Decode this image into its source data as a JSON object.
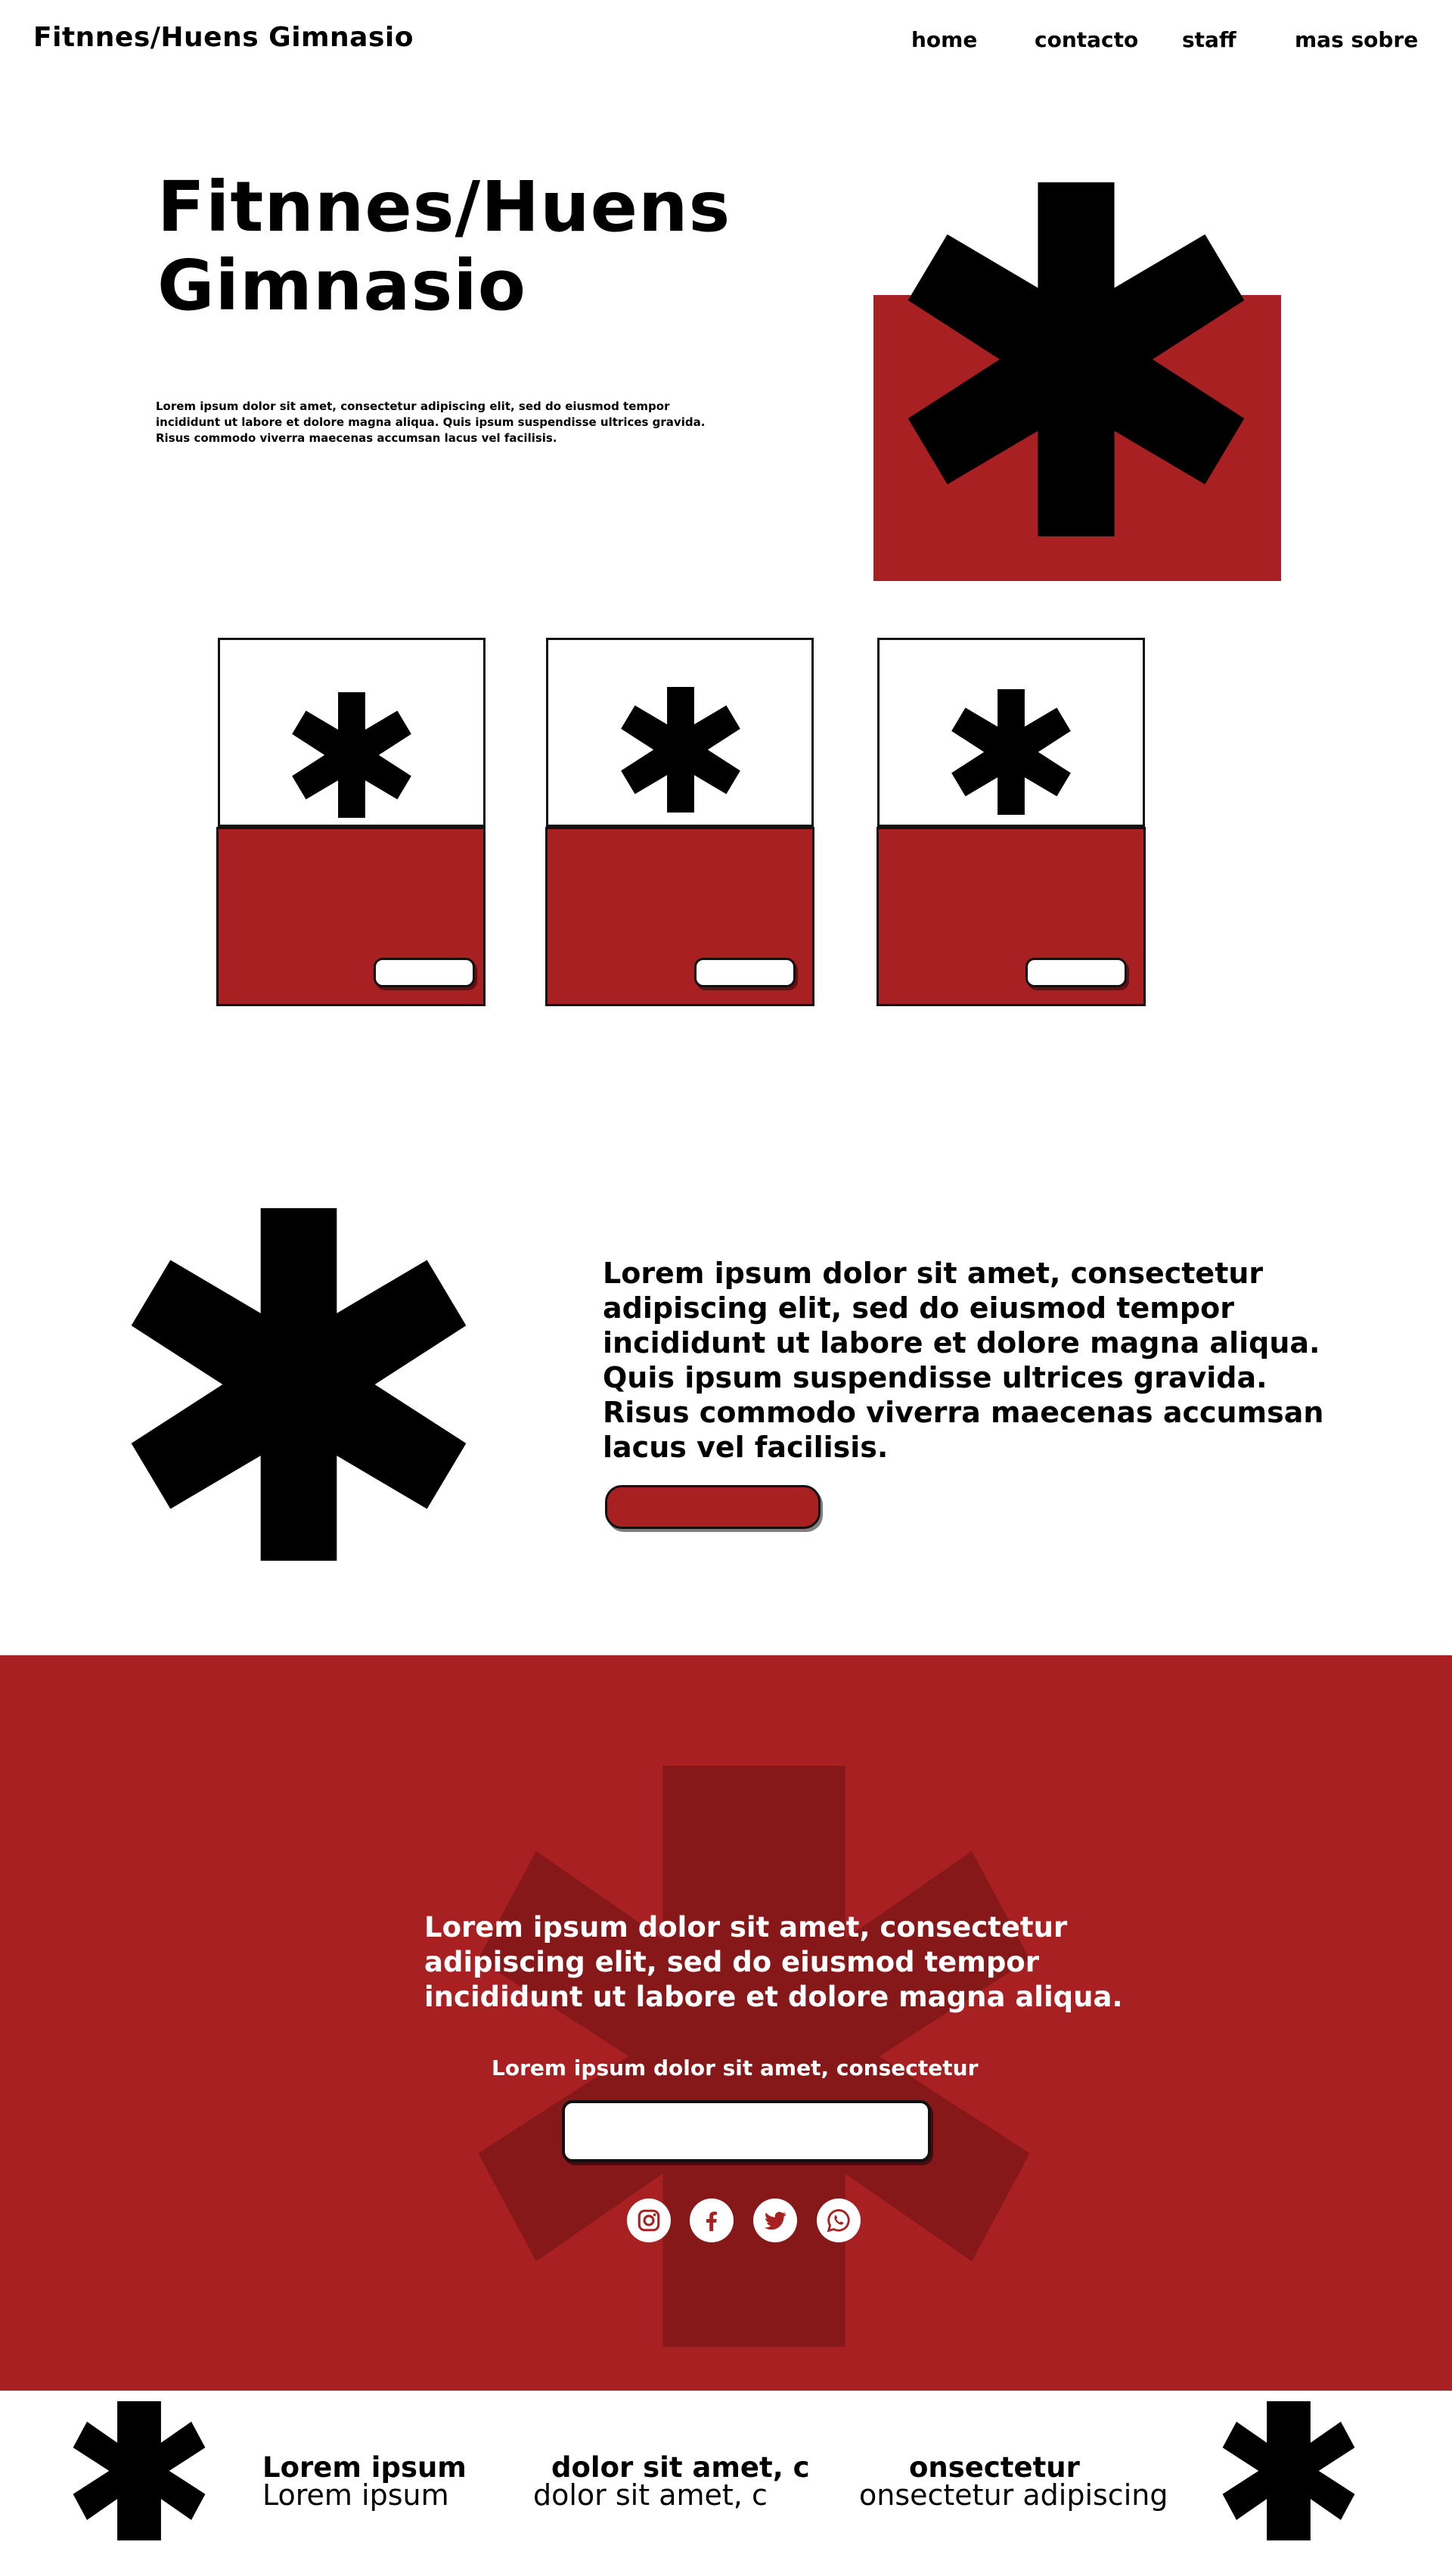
{
  "header": {
    "brand": "Fitnnes/Huens Gimnasio",
    "nav": [
      {
        "label": "home"
      },
      {
        "label": "contacto"
      },
      {
        "label": "staff"
      },
      {
        "label": "mas sobre"
      }
    ]
  },
  "hero": {
    "title": "Fitnnes/Huens Gimnasio",
    "body": "Lorem ipsum dolor sit amet, consectetur adipiscing elit, sed do eiusmod tempor incididunt ut labore et dolore magna aliqua. Quis ipsum suspendisse ultrices gravida. Risus commodo viverra maecenas accumsan lacus vel facilisis."
  },
  "feature": {
    "text": "Lorem ipsum dolor sit amet, consectetur adipiscing elit, sed do eiusmod tempor incididunt ut labore et dolore magna aliqua. Quis ipsum suspendisse ultrices gravida. Risus commodo viverra maecenas accumsan lacus vel facilisis."
  },
  "newsletter": {
    "heading": "Lorem ipsum dolor sit amet, consectetur adipiscing elit, sed do eiusmod tempor incididunt ut labore et dolore magna aliqua.",
    "subheading": "Lorem ipsum dolor sit amet, consectetur",
    "social": [
      {
        "icon": "instagram-icon"
      },
      {
        "icon": "facebook-icon"
      },
      {
        "icon": "twitter-icon"
      },
      {
        "icon": "whatsapp-icon"
      }
    ]
  },
  "footer": {
    "columns": [
      {
        "title": "Lorem ipsum",
        "text": "Lorem ipsum"
      },
      {
        "title": "dolor sit amet, c",
        "text": "dolor sit amet, c"
      },
      {
        "title": "onsectetur",
        "text": "onsectetur adipiscing"
      }
    ]
  },
  "colors": {
    "accent_red": "#a92023",
    "dark_red": "#87181a",
    "text": "#000000",
    "background": "#ffffff"
  }
}
